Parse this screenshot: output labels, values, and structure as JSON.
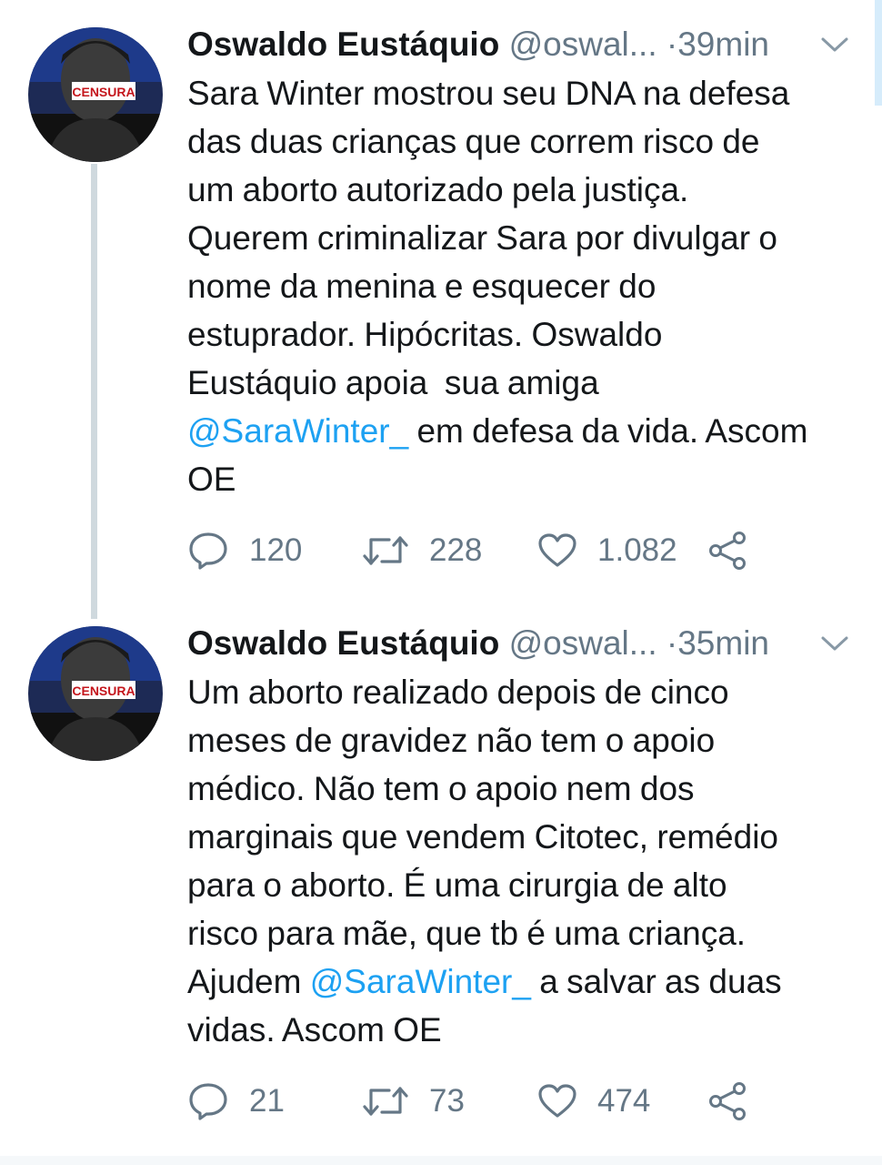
{
  "colors": {
    "link": "#1da1f2",
    "secondary_text": "#657786",
    "primary_text": "#14171a",
    "thread_line": "#cfd9de"
  },
  "tweets": [
    {
      "author_name": "Oswaldo Eustáquio",
      "handle": "@oswal...",
      "separator": "·",
      "time": "39min",
      "text_before": "Sara Winter mostrou seu DNA na defesa\ndas duas crianças que correm risco de\num aborto autorizado pela justiça.\nQuerem criminalizar Sara por divulgar o\nnome da menina e esquecer do\nestuprador. Hipócritas. Oswaldo\nEustáquio apoia  sua amiga\n",
      "mention": "@SaraWinter_",
      "text_after": " em defesa da vida. Ascom\nOE",
      "replies": "120",
      "retweets": "228",
      "likes": "1.082",
      "avatar_label": "CENSURA"
    },
    {
      "author_name": "Oswaldo Eustáquio",
      "handle": "@oswal...",
      "separator": "·",
      "time": "35min",
      "text_before": "Um aborto realizado depois de cinco\nmeses de gravidez não tem o apoio\nmédico. Não tem o apoio nem dos\nmarginais que vendem Citotec, remédio\npara o aborto. É uma cirurgia de alto\nrisco para mãe, que tb é uma criança.\nAjudem ",
      "mention": "@SaraWinter_",
      "text_after": " a salvar as duas\nvidas. Ascom OE",
      "replies": "21",
      "retweets": "73",
      "likes": "474",
      "avatar_label": "CENSURA"
    }
  ],
  "icons": {
    "reply": "reply-icon",
    "retweet": "retweet-icon",
    "like": "like-icon",
    "share": "share-icon",
    "caret": "chevron-down-icon"
  }
}
